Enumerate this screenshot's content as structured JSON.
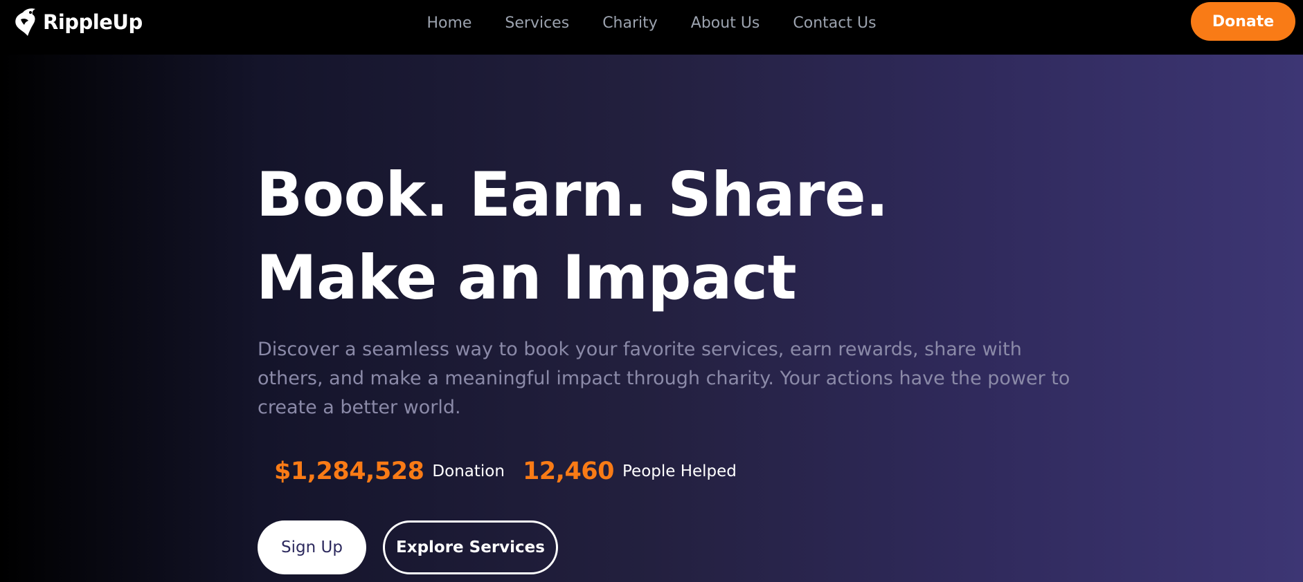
{
  "brand": {
    "name": "RippleUp",
    "logo_icon": "ripple-drop-icon"
  },
  "nav": {
    "items": [
      {
        "label": "Home"
      },
      {
        "label": "Services"
      },
      {
        "label": "Charity"
      },
      {
        "label": "About Us"
      },
      {
        "label": "Contact Us"
      }
    ],
    "donate_label": "Donate"
  },
  "hero": {
    "title_line1": "Book. Earn. Share.",
    "title_line2": "Make an Impact",
    "description": "Discover a seamless way to book your favorite services, earn rewards, share with others, and make a meaningful impact through charity. Your actions have the power to create a better world.",
    "stats": [
      {
        "value": "$1,284,528",
        "label": "Donation"
      },
      {
        "value": "12,460",
        "label": "People Helped"
      }
    ],
    "signup_label": "Sign Up",
    "explore_label": "Explore Services"
  },
  "colors": {
    "accent": "#f97b16",
    "nav_text": "#9ca3af",
    "hero_gradient_start": "#000000",
    "hero_gradient_end": "#3d3674",
    "description_text": "#8b8aa8",
    "signup_text": "#2d2a5e"
  }
}
